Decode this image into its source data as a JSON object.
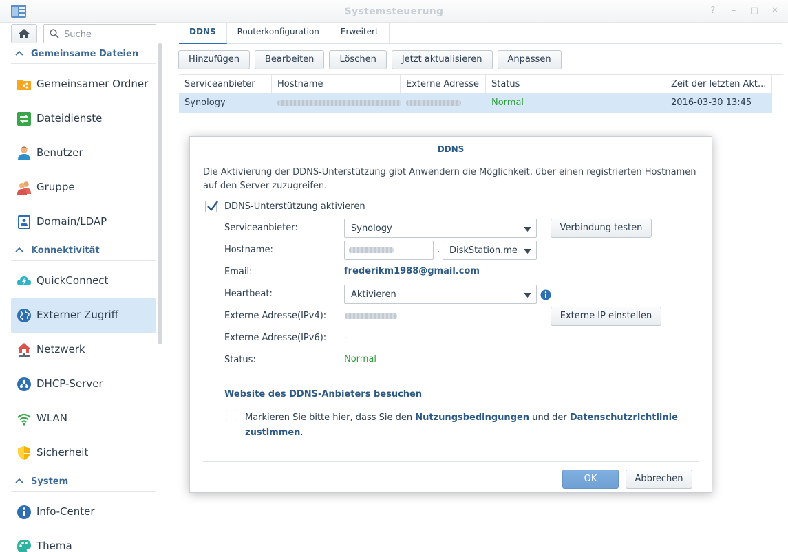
{
  "window": {
    "title": "Systemsteuerung",
    "controls": [
      "?",
      "–",
      "□",
      "✕"
    ]
  },
  "sidebar": {
    "search_placeholder": "Suche",
    "sections": [
      {
        "title": "Gemeinsame Dateien",
        "items": [
          {
            "label": "Gemeinsamer Ordner",
            "icon": "shared-folder-icon"
          },
          {
            "label": "Dateidienste",
            "icon": "file-services-icon"
          },
          {
            "label": "Benutzer",
            "icon": "user-icon"
          },
          {
            "label": "Gruppe",
            "icon": "group-icon"
          },
          {
            "label": "Domain/LDAP",
            "icon": "domain-ldap-icon"
          }
        ]
      },
      {
        "title": "Konnektivität",
        "items": [
          {
            "label": "QuickConnect",
            "icon": "quickconnect-icon"
          },
          {
            "label": "Externer Zugriff",
            "icon": "external-access-icon",
            "active": true
          },
          {
            "label": "Netzwerk",
            "icon": "network-icon"
          },
          {
            "label": "DHCP-Server",
            "icon": "dhcp-server-icon"
          },
          {
            "label": "WLAN",
            "icon": "wlan-icon"
          },
          {
            "label": "Sicherheit",
            "icon": "security-icon"
          }
        ]
      },
      {
        "title": "System",
        "items": [
          {
            "label": "Info-Center",
            "icon": "info-center-icon"
          },
          {
            "label": "Thema",
            "icon": "theme-icon"
          }
        ]
      }
    ]
  },
  "tabs": [
    "DDNS",
    "Routerkonfiguration",
    "Erweitert"
  ],
  "toolbar": [
    "Hinzufügen",
    "Bearbeiten",
    "Löschen",
    "Jetzt aktualisieren",
    "Anpassen"
  ],
  "grid": {
    "columns": [
      "Serviceanbieter",
      "Hostname",
      "Externe Adresse",
      "Status",
      "Zeit der letzten Akt..."
    ],
    "rows": [
      {
        "provider": "Synology",
        "hostname": "",
        "external_address": "",
        "status": "Normal",
        "last_update": "2016-03-30 13:45"
      }
    ]
  },
  "dialog": {
    "title": "DDNS",
    "description": "Die Aktivierung der DDNS-Unterstützung gibt Anwendern die Möglichkeit, über einen registrierten Hostnamen auf den Server zuzugreifen.",
    "enable_label": "DDNS-Unterstützung aktivieren",
    "enable_checked": true,
    "fields": {
      "provider_label": "Serviceanbieter:",
      "provider_value": "Synology",
      "test_button": "Verbindung testen",
      "hostname_label": "Hostname:",
      "hostname_dot": ".",
      "domain_value": "DiskStation.me",
      "email_label": "Email:",
      "email_value": "frederikm1988@gmail.com",
      "heartbeat_label": "Heartbeat:",
      "heartbeat_value": "Aktivieren",
      "ipv4_label": "Externe Adresse(IPv4):",
      "set_ip_button": "Externe IP einstellen",
      "ipv6_label": "Externe Adresse(IPv6):",
      "ipv6_value": "-",
      "status_label": "Status:",
      "status_value": "Normal"
    },
    "provider_link": "Website des DDNS-Anbieters besuchen",
    "terms": {
      "checked": false,
      "part1": "Markieren Sie bitte hier, dass Sie den",
      "link1": "Nutzungsbedingungen",
      "part2": "und der",
      "link2": "Datenschutzrichtlinie",
      "line2_link": "zustimmen",
      "line2_end": "."
    },
    "ok": "OK",
    "cancel": "Abbrechen"
  },
  "colors": {
    "accent": "#2d5a85",
    "selection": "#d6e8f7",
    "status_ok": "#2e9e3a",
    "primary_button": "#3a7dc4"
  }
}
